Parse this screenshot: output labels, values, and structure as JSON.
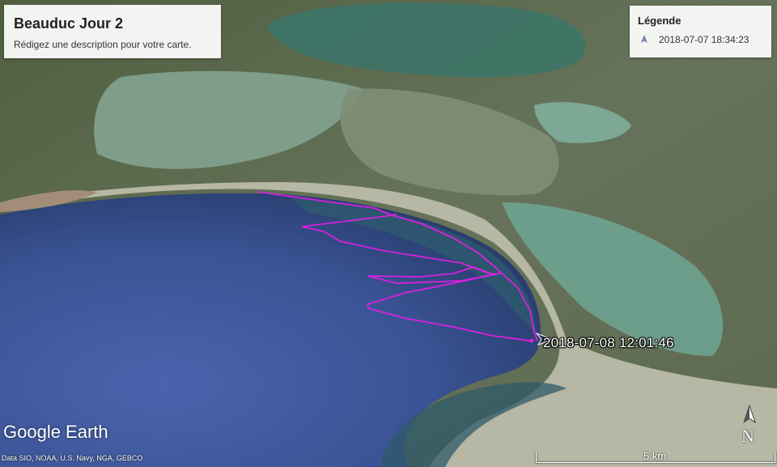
{
  "title": {
    "name": "Beauduc Jour 2",
    "description": "Rédigez une description pour votre carte."
  },
  "legend": {
    "heading": "Légende",
    "items": [
      {
        "label": "2018-07-07 18:34:23",
        "icon": "navigation-arrow-icon",
        "color": "#6a83a8"
      }
    ]
  },
  "track": {
    "color": "#e11ee6",
    "end_label": "2018-07-08 12:01:46"
  },
  "branding": {
    "logo": "Google Earth",
    "credits": "Data SIO, NOAA, U.S. Navy, NGA, GEBCO"
  },
  "scale_bar": {
    "label": "5 km"
  },
  "compass": {
    "label": "N",
    "icon": "north-arrow-icon"
  }
}
